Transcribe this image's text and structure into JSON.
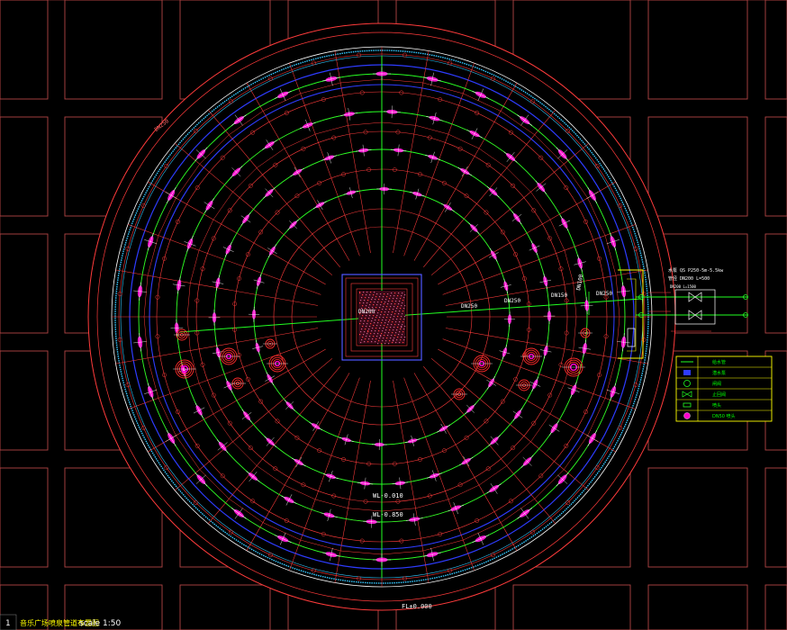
{
  "drawing": {
    "title": "音乐广场喷泉管道布置图",
    "scale": "scale 1:50",
    "sheet_index": "1"
  },
  "colors": {
    "background": "#000000",
    "grid": "#b34545",
    "radial": "#ff3b3b",
    "ring_blue": "#2e3cff",
    "ring_cyan": "#35c8ff",
    "pipe_green": "#22ff22",
    "nozzle": "#ff00cc",
    "frame_yellow": "#ffff00",
    "text": "#ffffff"
  },
  "labels": {
    "pipe_dn250": "DN250",
    "pipe_dn200": "DN200",
    "pipe_dn150": "DN150",
    "pipe_dn100": "DN100",
    "level_wl1": "WL-0.010",
    "level_wl2": "WL-0.850",
    "level_fl": "FL±0.000",
    "top_left_tag": "DN250",
    "pump_note_1": "水泵 QS P250-5m-5.5kw",
    "pump_note_2": "管径 DN200 L=500",
    "pump_note_3": "DN200 L=1500"
  },
  "legend": {
    "rows": [
      {
        "symbol": "line",
        "text": "给水管"
      },
      {
        "symbol": "rect",
        "text": "潜水泵"
      },
      {
        "symbol": "circle",
        "text": "闸阀"
      },
      {
        "symbol": "valve",
        "text": "止回阀"
      },
      {
        "symbol": "bar",
        "text": "喷头"
      },
      {
        "symbol": "dot",
        "text": "DN50 喷头"
      }
    ]
  }
}
